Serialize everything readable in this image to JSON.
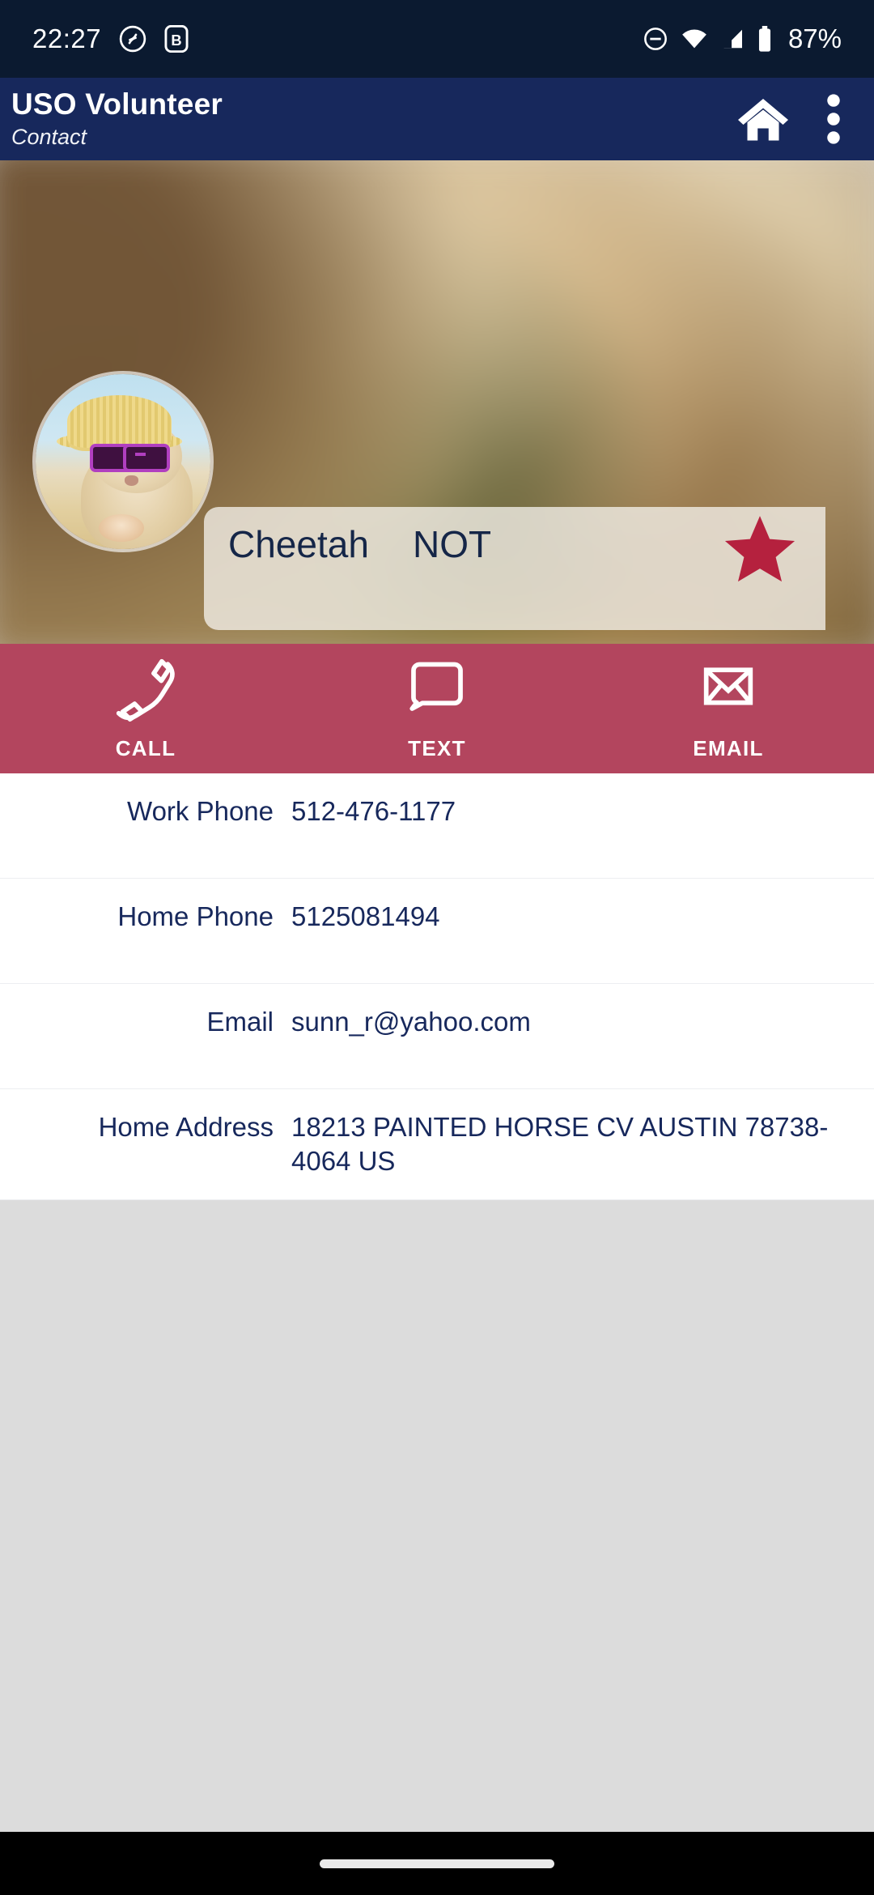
{
  "status_bar": {
    "time": "22:27",
    "battery_percent": "87%",
    "icons": [
      "shazam-icon",
      "bold-badge-icon",
      "do-not-disturb-icon",
      "wifi-icon",
      "cellular-signal-icon",
      "battery-icon"
    ]
  },
  "app_bar": {
    "title": "USO Volunteer",
    "subtitle": "Contact",
    "actions": [
      "home-icon",
      "overflow-menu-icon"
    ]
  },
  "profile": {
    "first_name": "Cheetah",
    "last_name": "NOT",
    "avatar_alt": "cat-in-straw-hat-and-sunglasses",
    "favorite_star": true,
    "star_color": "#b5213e"
  },
  "action_bar": {
    "background_color": "#a91f3e",
    "actions": [
      {
        "icon": "phone-icon",
        "label": "CALL"
      },
      {
        "icon": "message-bubble-icon",
        "label": "TEXT"
      },
      {
        "icon": "envelope-icon",
        "label": "EMAIL"
      }
    ]
  },
  "details": [
    {
      "label": "Work Phone",
      "value": "512-476-1177"
    },
    {
      "label": "Home Phone",
      "value": "5125081494"
    },
    {
      "label": "Email",
      "value": "sunn_r@yahoo.com"
    },
    {
      "label": "Home Address",
      "value": "18213 PAINTED HORSE CV AUSTIN 78738-4064 US"
    }
  ],
  "theme": {
    "status_bar_bg": "#0b1a30",
    "app_bar_bg": "#17285c",
    "text_navy": "#17285c",
    "page_bg": "#dcdcdc"
  }
}
